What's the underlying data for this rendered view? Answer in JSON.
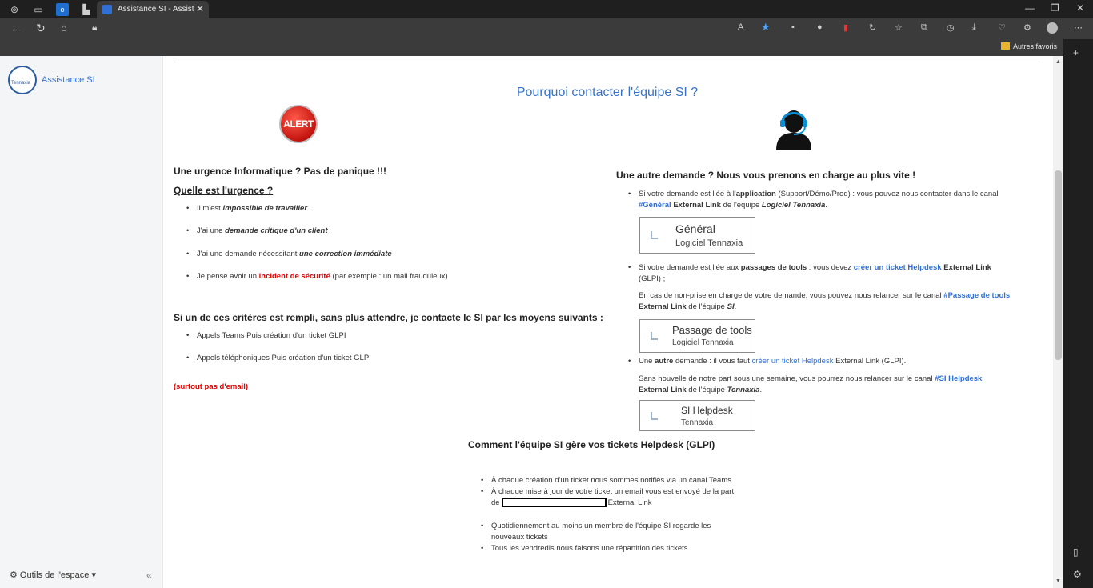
{
  "browser": {
    "tab_title": "Assistance SI - Assistance",
    "bookmark_folder": "Autres favoris"
  },
  "sidebar": {
    "logo_text": "Tennaxia",
    "space_name": "Assistance SI",
    "tools_label": "Outils de l'espace",
    "tools_chevron": "▾",
    "collapse_icon": "«"
  },
  "page": {
    "title": "Pourquoi contacter l'équipe SI ?",
    "alert_text": "ALERT",
    "left": {
      "heading": "Une urgence Informatique ? Pas de panique !!!",
      "question": "Quelle est l'urgence ?",
      "items": [
        {
          "pre": "Il m'est ",
          "em": "impossible de travailler",
          "post": ""
        },
        {
          "pre": "J'ai une ",
          "em": "demande critique d'un client",
          "post": ""
        },
        {
          "pre": "J'ai une demande nécessitant ",
          "em": "une correction immédiate",
          "post": ""
        },
        {
          "pre": "Je pense avoir un ",
          "em": "incident de sécurité",
          "post": " (par exemple : un mail frauduleux)"
        }
      ],
      "criteria_heading": "Si un de ces critères est rempli, sans plus attendre, je contacte le SI par les moyens suivants :",
      "means": [
        "Appels Teams Puis création d'un ticket GLPI",
        "Appels téléphoniques Puis création d'un ticket GLPI"
      ],
      "no_email": "(surtout pas d'email)"
    },
    "right": {
      "heading": "Une autre demande ? Nous vous prenons en charge au plus vite !",
      "b1": {
        "t1": "Si votre demande est liée à l'",
        "t2": "application",
        "t3": " (Support/Démo/Prod) : vous pouvez nous contacter dans le canal",
        "channel": "#Général",
        "ext": "External Link",
        "t4": " de l'équipe ",
        "team": "Logiciel Tennaxia",
        "t5": "."
      },
      "card1": {
        "title": "Général",
        "sub": "Logiciel Tennaxia"
      },
      "b2": {
        "t1": "Si votre demande est liée aux ",
        "t2": "passages de tools",
        "t3": " : vous devez ",
        "link": "créer un ticket Helpdesk",
        "ext": "External Link",
        "t4": "(GLPI) ;"
      },
      "p2": {
        "t1": "En cas de non-prise en charge de votre demande, vous pouvez nous relancer sur le canal ",
        "channel": "#Passage de tools",
        "ext": "External Link",
        "t2": " de l'équipe ",
        "team": "SI",
        "t3": "."
      },
      "card2": {
        "title": "Passage de tools",
        "sub": "Logiciel Tennaxia"
      },
      "b3": {
        "t1": "Une ",
        "t2": "autre",
        "t3": " demande : il vous faut ",
        "link": "créer un ticket Helpdesk",
        "ext": "External Link",
        "t4": " (GLPI)."
      },
      "p3": {
        "t1": "Sans nouvelle de notre part sous une semaine, vous pourrez nous relancer sur le canal ",
        "channel": "#SI Helpdesk",
        "ext": "External Link",
        "t2": " de l'équipe ",
        "team": "Tennaxia",
        "t3": "."
      },
      "card3": {
        "title": "SI Helpdesk",
        "sub": "Tennaxia"
      }
    },
    "glpi": {
      "heading": "Comment l'équipe SI gère vos tickets Helpdesk (GLPI)",
      "i1": "À chaque création d'un ticket nous sommes notifiés via un canal Teams",
      "i2": "À chaque mise à jour de votre ticket un email vous est envoyé de la part",
      "i2_de": "de",
      "i2_ext": "External Link",
      "i3": "Quotidiennement au moins un membre de l'équipe SI regarde les nouveaux tickets",
      "i4": "Tous les vendredis nous faisons une répartition des tickets"
    }
  }
}
